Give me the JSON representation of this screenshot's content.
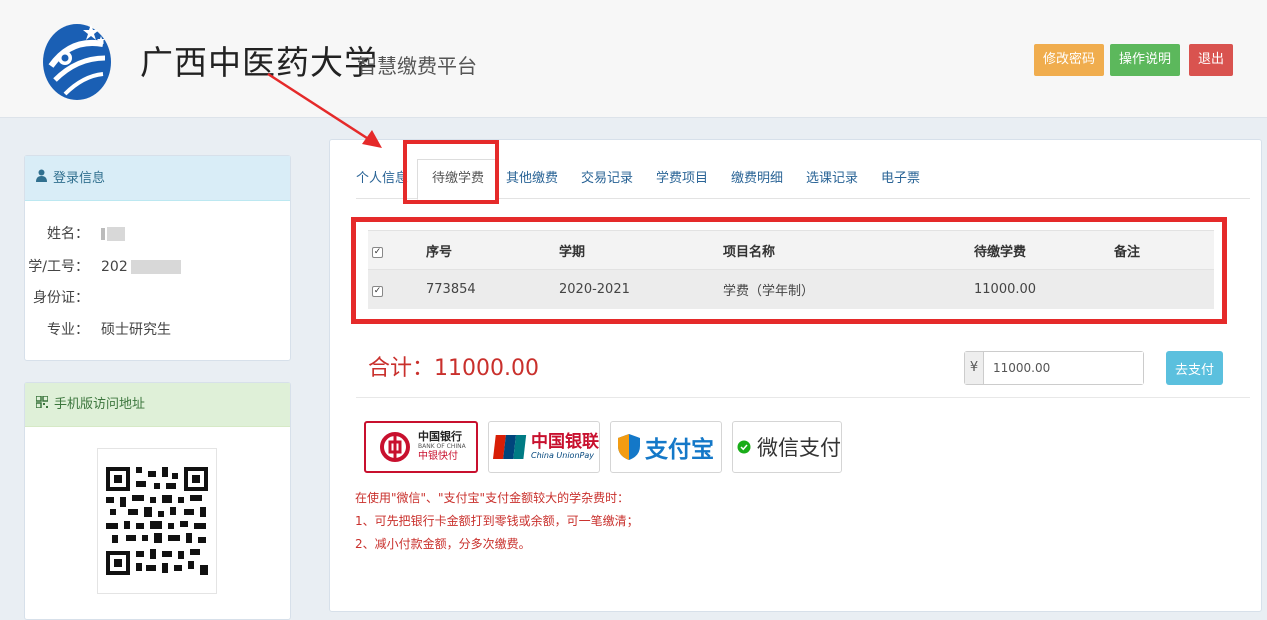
{
  "header": {
    "title": "广西中医药大学",
    "subtitle": "智慧缴费平台",
    "buttons": {
      "change_password": "修改密码",
      "help": "操作说明",
      "logout": "退出"
    }
  },
  "sidebar": {
    "login_panel": {
      "title": "登录信息",
      "rows": [
        {
          "label": "姓名：",
          "value": ""
        },
        {
          "label": "学/工号：",
          "value": "202"
        },
        {
          "label": "身份证：",
          "value": ""
        },
        {
          "label": "专业：",
          "value": "硕士研究生"
        }
      ]
    },
    "qr_panel": {
      "title": "手机版访问地址"
    }
  },
  "main": {
    "tabs": [
      "个人信息",
      "待缴学费",
      "其他缴费",
      "交易记录",
      "学费项目",
      "缴费明细",
      "选课记录",
      "电子票"
    ],
    "active_tab": "待缴学费",
    "table": {
      "headers": [
        "序号",
        "学期",
        "项目名称",
        "待缴学费",
        "备注"
      ],
      "rows": [
        {
          "id": "773854",
          "term": "2020-2021",
          "item": "学费（学年制）",
          "amount": "11000.00",
          "note": ""
        }
      ]
    },
    "total_label": "合计：11000.00",
    "currency_symbol": "¥",
    "pay_amount": "11000.00",
    "pay_button": "去支付",
    "payment_methods": {
      "boc": {
        "name": "中国银行",
        "sub": "中银快付",
        "en": "BANK OF CHINA"
      },
      "unionpay": {
        "name": "中国银联",
        "en": "China UnionPay"
      },
      "alipay": {
        "name": "支付宝"
      },
      "wechat": {
        "name": "微信支付"
      }
    },
    "notice": [
      "在使用\"微信\"、\"支付宝\"支付金额较大的学杂费时：",
      "1、可先把银行卡金额打到零钱或余额，可一笔缴清；",
      "2、减小付款金额，分多次缴费。"
    ]
  },
  "colors": {
    "highlight": "#e52a2a",
    "btn_warning": "#f0ad4e",
    "btn_success": "#5cb85c",
    "btn_danger": "#d9534f",
    "btn_info": "#5bc0de",
    "total_red": "#c9302c"
  }
}
